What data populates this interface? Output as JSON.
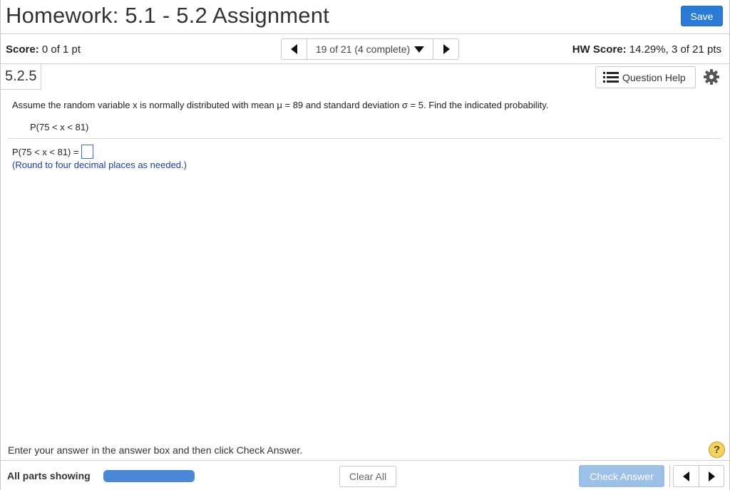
{
  "header": {
    "title": "Homework: 5.1 - 5.2 Assignment",
    "save_label": "Save"
  },
  "score_bar": {
    "score_label": "Score:",
    "score_value": "0 of 1 pt",
    "nav_position": "19 of 21 (4 complete)",
    "hw_score_label": "HW Score:",
    "hw_score_value": "14.29%, 3 of 21 pts"
  },
  "question": {
    "id": "5.2.5",
    "help_label": "Question Help",
    "text": "Assume the random variable x is normally distributed with mean μ = 89 and standard deviation σ = 5. Find the indicated probability.",
    "probability": "P(75 < x < 81)",
    "answer_prefix": "P(75 < x < 81) =",
    "answer_value": "",
    "round_note": "(Round to four decimal places as needed.)"
  },
  "footer": {
    "instruction": "Enter your answer in the answer box and then click Check Answer.",
    "help_symbol": "?",
    "parts_label": "All parts showing",
    "progress_fraction": 1.0,
    "clear_label": "Clear All",
    "check_label": "Check Answer"
  },
  "colors": {
    "accent": "#2b7bd6",
    "check_disabled": "#9cc0e6",
    "note": "#1a3d9c",
    "help_badge": "#f4d35e"
  }
}
